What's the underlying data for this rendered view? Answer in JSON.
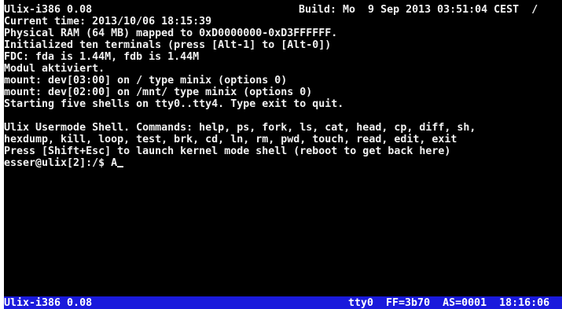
{
  "header": {
    "version": "Ulix-i386 0.08",
    "build": "Build: Mo  9 Sep 2013 03:51:04 CEST  /"
  },
  "boot_lines": [
    "Current time: 2013/10/06 18:15:39",
    "Physical RAM (64 MB) mapped to 0xD0000000-0xD3FFFFFF.",
    "Initialized ten terminals (press [Alt-1] to [Alt-0])",
    "FDC: fda is 1.44M, fdb is 1.44M",
    "Modul aktiviert.",
    "mount: dev[03:00] on / type minix (options 0)",
    "mount: dev[02:00] on /mnt/ type minix (options 0)",
    "Starting five shells on tty0..tty4. Type exit to quit."
  ],
  "shell_lines": [
    "Ulix Usermode Shell. Commands: help, ps, fork, ls, cat, head, cp, diff, sh,",
    "hexdump, kill, loop, test, brk, cd, ln, rm, pwd, touch, read, edit, exit",
    "Press [Shift+Esc] to launch kernel mode shell (reboot to get back here)"
  ],
  "prompt": {
    "text": "esser@ulix[2]:/$ ",
    "input": "A"
  },
  "statusbar": {
    "left": "Ulix-i386 0.08",
    "right": "tty0  FF=3b70  AS=0001  18:16:06"
  },
  "colors": {
    "background": "#000000",
    "text": "#f2f2f2",
    "statusbar": "#1a1adc"
  }
}
